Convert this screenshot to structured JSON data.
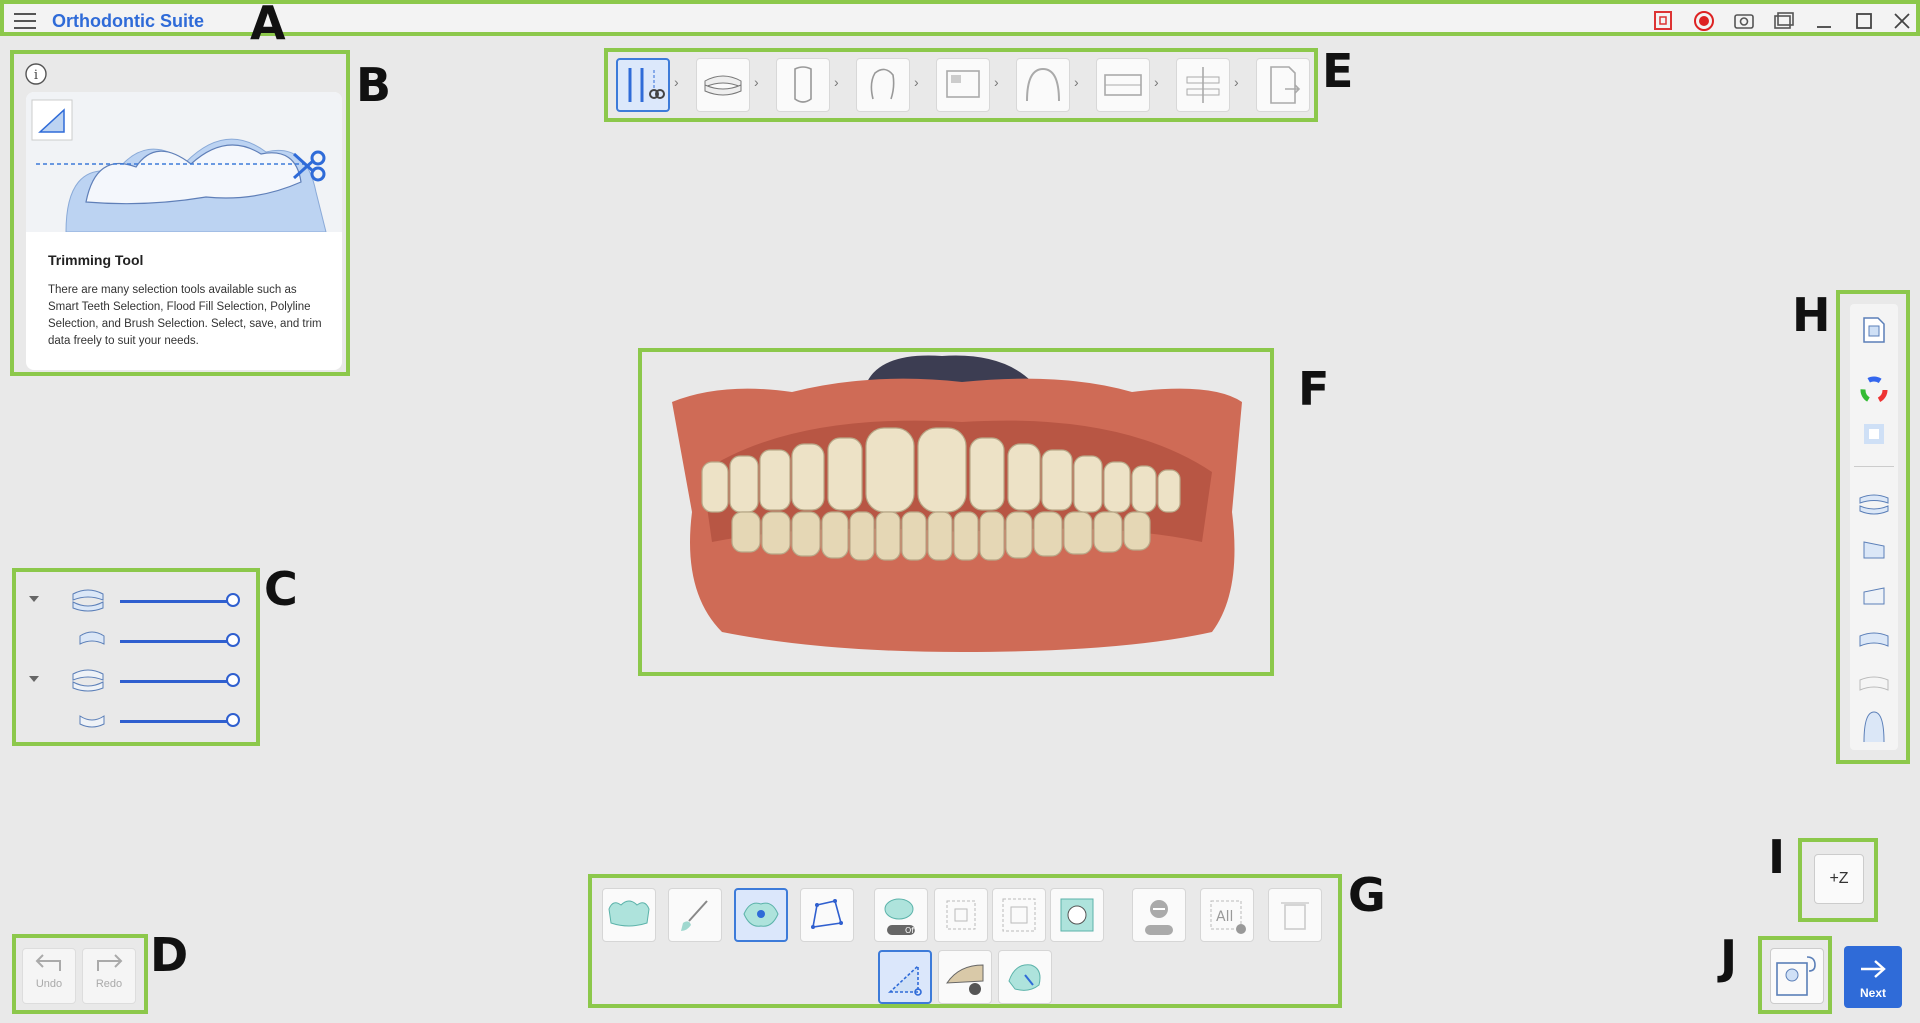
{
  "app": {
    "title": "Orthodontic Suite"
  },
  "titlebar": {
    "icons": [
      "screen-capture-icon",
      "record-icon",
      "camera-icon",
      "gallery-icon",
      "minimize-icon",
      "maximize-icon",
      "close-icon"
    ]
  },
  "callouts": {
    "a": "A",
    "b": "B",
    "c": "C",
    "d": "D",
    "e": "E",
    "f": "F",
    "g": "G",
    "h": "H",
    "i": "I",
    "j": "J"
  },
  "info_panel": {
    "title": "Trimming Tool",
    "description": "There are many selection tools available such as Smart Teeth Selection, Flood Fill Selection, Polyline Selection, and Brush Selection. Select, save, and trim data freely to suit your needs."
  },
  "steps": [
    "trim-step",
    "occlusion-step",
    "tooth-step",
    "face-step",
    "photo-step",
    "arch-step",
    "bite-step",
    "align-step",
    "export-step"
  ],
  "layers": {
    "rows": [
      "upper-jaw-group",
      "upper-jaw",
      "lower-jaw-group",
      "lower-jaw"
    ],
    "opacity": [
      100,
      100,
      100,
      100
    ]
  },
  "undo": {
    "label": "Undo"
  },
  "redo": {
    "label": "Redo"
  },
  "zbutton": {
    "label": "+Z"
  },
  "next": {
    "label": "Next"
  },
  "colors": {
    "accent": "#2f6bd8",
    "highlight": "#8cc84b",
    "gum": "#d9735f",
    "tooth": "#efe6cf"
  }
}
